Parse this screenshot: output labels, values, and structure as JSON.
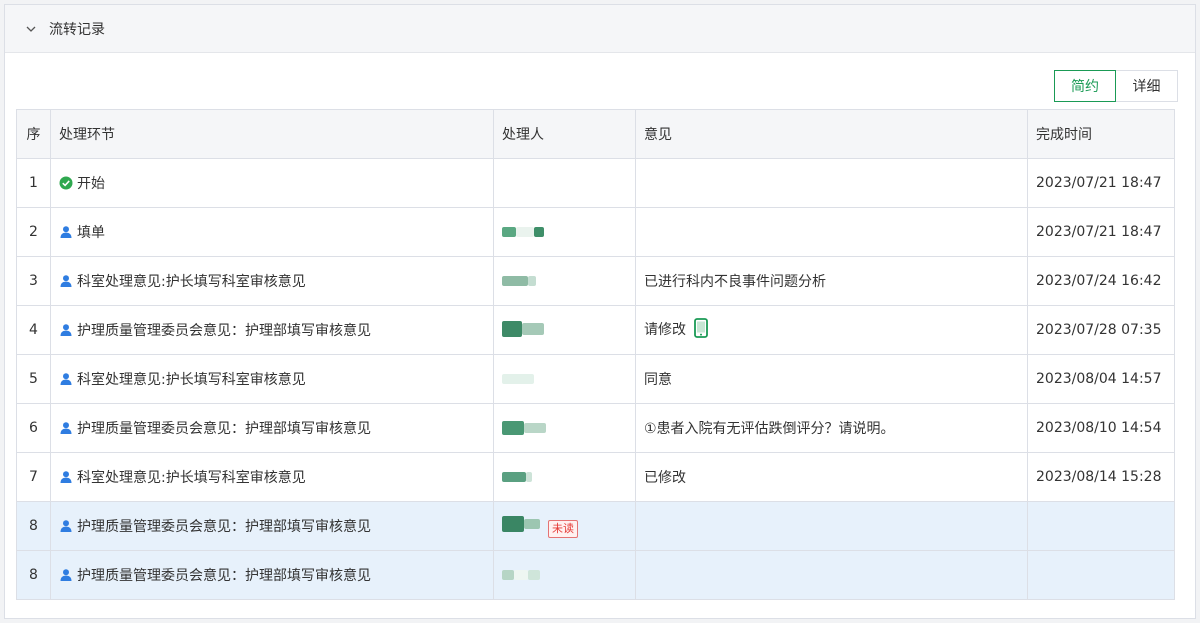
{
  "panel": {
    "title": "流转记录"
  },
  "toolbar": {
    "simple_label": "简约",
    "detail_label": "详细"
  },
  "table": {
    "headers": {
      "idx": "序",
      "step": "处理环节",
      "handler": "处理人",
      "opinion": "意见",
      "time": "完成时间"
    },
    "rows": [
      {
        "idx": "1",
        "step": "开始",
        "icon": "check-circle-icon",
        "opinion": "",
        "time": "2023/07/21 18:47"
      },
      {
        "idx": "2",
        "step": "填单",
        "icon": "user-icon",
        "opinion": "",
        "time": "2023/07/21 18:47"
      },
      {
        "idx": "3",
        "step": "科室处理意见:护长填写科室审核意见",
        "icon": "user-icon",
        "opinion": "已进行科内不良事件问题分析",
        "time": "2023/07/24 16:42"
      },
      {
        "idx": "4",
        "step": "护理质量管理委员会意见：护理部填写审核意见",
        "icon": "user-icon",
        "opinion": "请修改",
        "time": "2023/07/28 07:35"
      },
      {
        "idx": "5",
        "step": "科室处理意见:护长填写科室审核意见",
        "icon": "user-icon",
        "opinion": "同意",
        "time": "2023/08/04 14:57"
      },
      {
        "idx": "6",
        "step": "护理质量管理委员会意见：护理部填写审核意见",
        "icon": "user-icon",
        "opinion": "①患者入院有无评估跌倒评分？请说明。",
        "time": "2023/08/10 14:54"
      },
      {
        "idx": "7",
        "step": "科室处理意见:护长填写科室审核意见",
        "icon": "user-icon",
        "opinion": "已修改",
        "time": "2023/08/14 15:28"
      },
      {
        "idx": "8",
        "step": "护理质量管理委员会意见：护理部填写审核意见",
        "icon": "user-icon",
        "opinion": "",
        "time": "",
        "badge": "未读"
      },
      {
        "idx": "8",
        "step": "护理质量管理委员会意见：护理部填写审核意见",
        "icon": "user-icon",
        "opinion": "",
        "time": ""
      }
    ]
  },
  "colors": {
    "accent": "#1a9a55",
    "user_icon": "#2f7de1",
    "highlight_row": "#e7f1fb",
    "unread": "#e53935"
  }
}
